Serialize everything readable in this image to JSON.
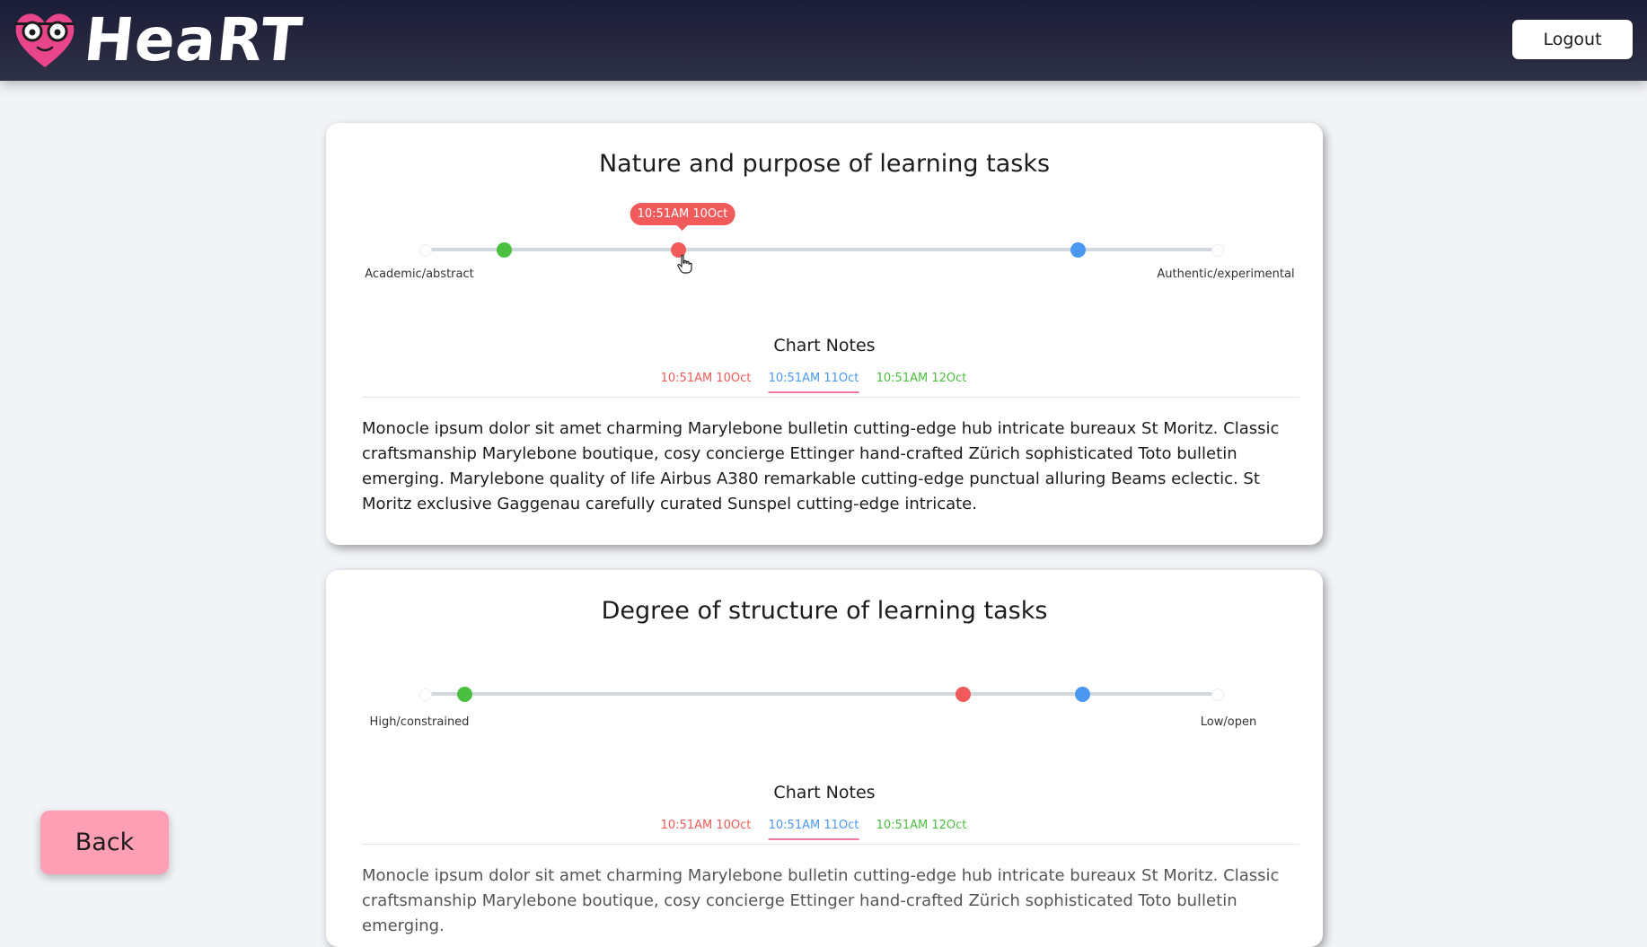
{
  "header": {
    "logo_text": "HeaRT",
    "logout_label": "Logout"
  },
  "colors": {
    "red": "#f05a5a",
    "blue": "#4a98f0",
    "green": "#4bbf3f",
    "back_button": "#ff9fb5"
  },
  "cards": [
    {
      "title": "Nature and purpose of learning tasks",
      "left_label": "Academic/abstract",
      "right_label": "Authentic/experimental",
      "tooltip": "10:51AM 10Oct",
      "markers": [
        {
          "label": "10:51AM 10Oct",
          "color": "#f05a5a",
          "value": 0.32
        },
        {
          "label": "10:51AM 11Oct",
          "color": "#4a98f0",
          "value": 0.825
        },
        {
          "label": "10:51AM 12Oct",
          "color": "#4bbf3f",
          "value": 0.1
        }
      ],
      "notes_title": "Chart Notes",
      "tabs": [
        "10:51AM 10Oct",
        "10:51AM 11Oct",
        "10:51AM 12Oct"
      ],
      "active_tab": 1,
      "notes": "Monocle ipsum dolor sit amet charming Marylebone bulletin cutting-edge hub intricate bureaux St Moritz. Classic craftsmanship Marylebone boutique, cosy concierge Ettinger hand-crafted Zürich sophisticated Toto bulletin emerging. Marylebone quality of life Airbus A380 remarkable cutting-edge punctual alluring Beams eclectic. St Moritz exclusive Gaggenau carefully curated Sunspel cutting-edge intricate."
    },
    {
      "title": "Degree of structure of learning tasks",
      "left_label": "High/constrained",
      "right_label": "Low/open",
      "markers": [
        {
          "label": "10:51AM 10Oct",
          "color": "#f05a5a",
          "value": 0.68
        },
        {
          "label": "10:51AM 11Oct",
          "color": "#4a98f0",
          "value": 0.83
        },
        {
          "label": "10:51AM 12Oct",
          "color": "#4bbf3f",
          "value": 0.05
        }
      ],
      "notes_title": "Chart Notes",
      "tabs": [
        "10:51AM 10Oct",
        "10:51AM 11Oct",
        "10:51AM 12Oct"
      ],
      "active_tab": 1,
      "notes": "Monocle ipsum dolor sit amet charming Marylebone bulletin cutting-edge hub intricate bureaux St Moritz. Classic craftsmanship Marylebone boutique, cosy concierge Ettinger hand-crafted Zürich sophisticated Toto bulletin emerging."
    }
  ],
  "back_label": "Back"
}
